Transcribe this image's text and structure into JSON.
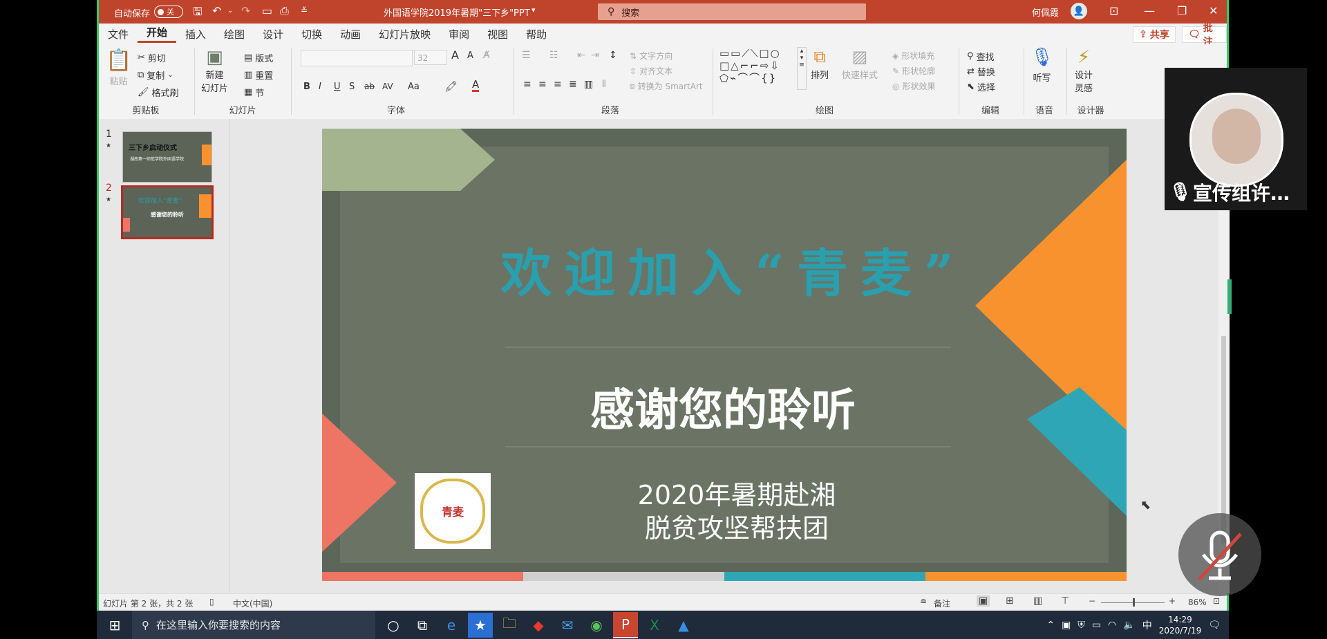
{
  "title_bar": {
    "autosave_label": "自动保存",
    "autosave_state": "关",
    "doc_title": "外国语学院2019年暑期\"三下乡\"PPT",
    "search_placeholder": "搜索",
    "user_name": "何佩霞"
  },
  "menu": [
    "文件",
    "开始",
    "插入",
    "绘图",
    "设计",
    "切换",
    "动画",
    "幻灯片放映",
    "审阅",
    "视图",
    "帮助"
  ],
  "menu_right": {
    "share": "共享",
    "comments": "批注"
  },
  "ribbon": {
    "clipboard": {
      "paste": "粘贴",
      "cut": "剪切",
      "copy": "复制",
      "format_painter": "格式刷",
      "label": "剪贴板"
    },
    "slides": {
      "new_slide": "新建",
      "new_slide_2": "幻灯片",
      "layout": "版式",
      "reset": "重置",
      "section": "节",
      "label": "幻灯片"
    },
    "font": {
      "size": "32",
      "label": "字体",
      "bold": "B",
      "italic": "I",
      "underline": "U",
      "shadow": "S",
      "strike": "ab",
      "spacing": "AV",
      "case": "Aa",
      "grow": "A",
      "shrink": "A"
    },
    "paragraph": {
      "text_direction": "文字方向",
      "align_text": "对齐文本",
      "smartart": "转换为 SmartArt",
      "label": "段落"
    },
    "drawing": {
      "arrange": "排列",
      "quick_styles": "快速样式",
      "shape_fill": "形状填充",
      "shape_outline": "形状轮廓",
      "shape_effects": "形状效果",
      "label": "绘图"
    },
    "editing": {
      "find": "查找",
      "replace": "替换",
      "select": "选择",
      "label": "编辑"
    },
    "voice": {
      "dictate": "听写",
      "label": "语音"
    },
    "designer": {
      "design_ideas": "设计",
      "design_ideas_2": "灵感",
      "label": "设计器"
    }
  },
  "thumbnails": [
    {
      "num": "1",
      "star": "★",
      "title": "三下乡启动仪式",
      "subtitle": "湖南第一师范学院外国语学院"
    },
    {
      "num": "2",
      "star": "★",
      "title": "欢迎加入“青麦”",
      "subtitle": "感谢您的聆听"
    }
  ],
  "slide": {
    "heading": "欢迎加入“青麦”",
    "thanks": "感谢您的聆听",
    "line1": "2020年暑期赴湘",
    "line2": "脱贫攻坚帮扶团",
    "logo_text": "青麦"
  },
  "status": {
    "slide_info": "幻灯片 第 2 张，共 2 张",
    "language": "中文(中国)",
    "notes": "备注",
    "zoom": "86%"
  },
  "taskbar": {
    "search_placeholder": "在这里输入你要搜索的内容",
    "ime": "中",
    "time": "14:29",
    "date": "2020/7/19"
  },
  "meeting": {
    "participant": "宣传组许…"
  },
  "colors": {
    "title_bar": "#c0432b",
    "accent_orange": "#f7922e",
    "accent_teal": "#2fa6b5",
    "accent_coral": "#ee7563",
    "heading_teal": "#2a9fae"
  }
}
